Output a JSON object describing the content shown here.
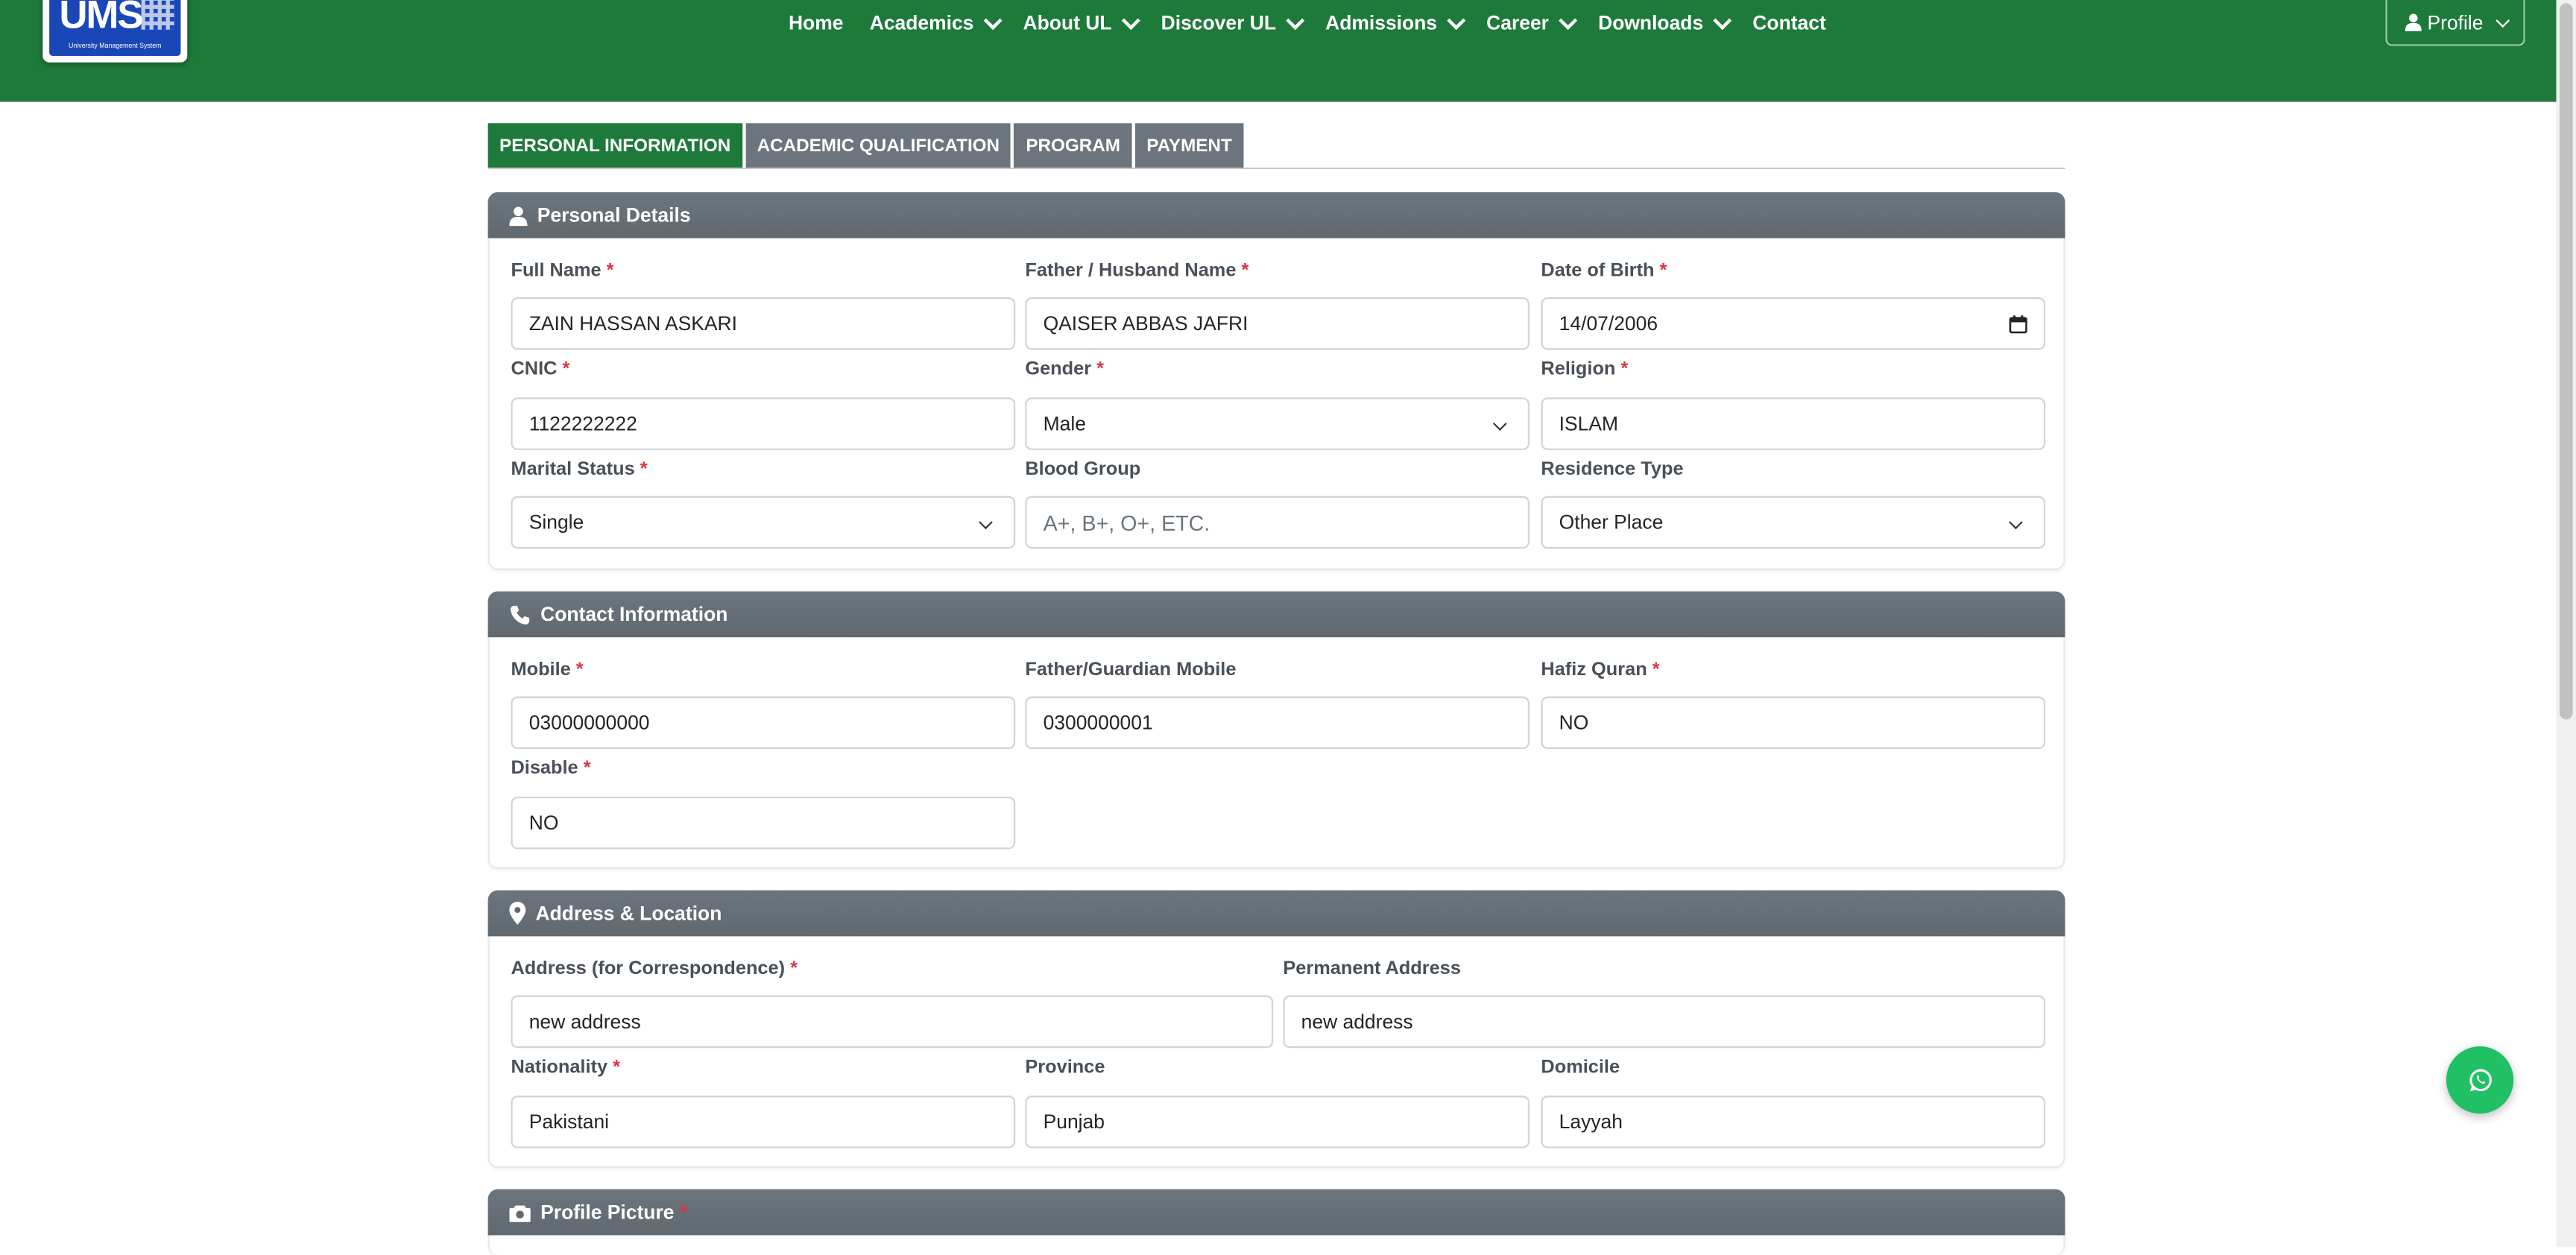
{
  "header": {
    "logo_text": "UMS",
    "logo_sub": "University Management System",
    "nav": [
      {
        "label": "Home",
        "dropdown": false
      },
      {
        "label": "Academics",
        "dropdown": true
      },
      {
        "label": "About UL",
        "dropdown": true
      },
      {
        "label": "Discover UL",
        "dropdown": true
      },
      {
        "label": "Admissions",
        "dropdown": true
      },
      {
        "label": "Career",
        "dropdown": true
      },
      {
        "label": "Downloads",
        "dropdown": true
      },
      {
        "label": "Contact",
        "dropdown": false
      }
    ],
    "profile_label": "Profile"
  },
  "tabs": [
    {
      "label": "PERSONAL INFORMATION",
      "active": true
    },
    {
      "label": "ACADEMIC QUALIFICATION",
      "active": false
    },
    {
      "label": "PROGRAM",
      "active": false
    },
    {
      "label": "PAYMENT",
      "active": false
    }
  ],
  "personal": {
    "title": "Personal Details",
    "full_name_label": "Full Name",
    "full_name": "ZAIN HASSAN ASKARI",
    "father_label": "Father / Husband Name",
    "father": "QAISER ABBAS JAFRI",
    "dob_label": "Date of Birth",
    "dob": "14/07/2006",
    "cnic_label": "CNIC",
    "cnic": "1122222222",
    "gender_label": "Gender",
    "gender": "Male",
    "religion_label": "Religion",
    "religion": "ISLAM",
    "marital_label": "Marital Status",
    "marital": "Single",
    "blood_label": "Blood Group",
    "blood_placeholder": "A+, B+, O+, ETC.",
    "residence_label": "Residence Type",
    "residence": "Other Place"
  },
  "contact": {
    "title": "Contact Information",
    "mobile_label": "Mobile",
    "mobile": "03000000000",
    "guardian_label": "Father/Guardian Mobile",
    "guardian": "0300000001",
    "hafiz_label": "Hafiz Quran",
    "hafiz": "NO",
    "disable_label": "Disable",
    "disable": "NO"
  },
  "address": {
    "title": "Address & Location",
    "corr_label": "Address (for Correspondence)",
    "corr": "new address",
    "perm_label": "Permanent Address",
    "perm": "new address",
    "nationality_label": "Nationality",
    "nationality": "Pakistani",
    "province_label": "Province",
    "province": "Punjab",
    "domicile_label": "Domicile",
    "domicile": "Layyah"
  },
  "picture": {
    "title": "Profile Picture"
  },
  "required_mark": "*",
  "colors": {
    "header_green": "#1e7a3a",
    "card_head": "#6c757d",
    "required": "#dc3545",
    "whatsapp": "#21c064"
  }
}
